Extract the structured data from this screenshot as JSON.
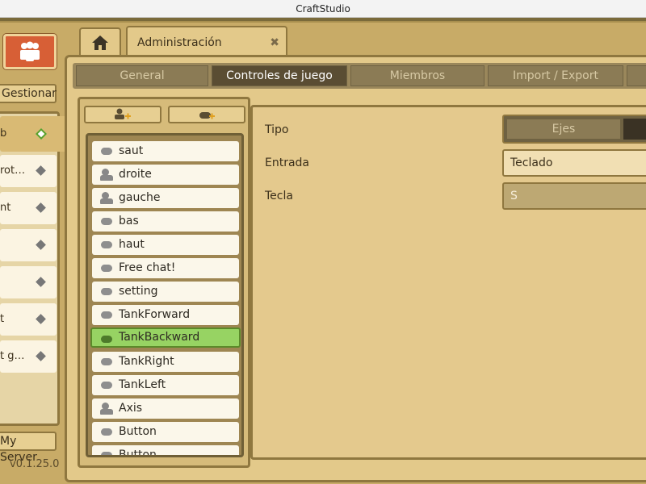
{
  "window": {
    "title": "CraftStudio"
  },
  "sidebar": {
    "manage_label": "Gestionar",
    "projects": [
      {
        "label": "b",
        "selected": true
      },
      {
        "label": "rot…"
      },
      {
        "label": "nt"
      },
      {
        "label": ""
      },
      {
        "label": ""
      },
      {
        "label": "t"
      },
      {
        "label": "t g…"
      }
    ],
    "server_label": "My Server",
    "version": "v0.1.25.0"
  },
  "tabs": {
    "home_icon": "home-icon",
    "admin_label": "Administración",
    "admin_close": "✖"
  },
  "subtabs": [
    "General",
    "Controles de juego",
    "Miembros",
    "Import / Export"
  ],
  "active_subtab": "Controles de juego",
  "controls": [
    {
      "label": "saut",
      "icon": "button-pill-icon"
    },
    {
      "label": "droite",
      "icon": "axis-person-icon"
    },
    {
      "label": "gauche",
      "icon": "axis-person-icon"
    },
    {
      "label": "bas",
      "icon": "button-pill-icon"
    },
    {
      "label": "haut",
      "icon": "button-pill-icon"
    },
    {
      "label": "Free chat!",
      "icon": "button-pill-icon"
    },
    {
      "label": "setting",
      "icon": "button-pill-icon"
    },
    {
      "label": "TankForward",
      "icon": "button-pill-icon"
    },
    {
      "label": "TankBackward",
      "icon": "button-pill-icon",
      "selected": true
    },
    {
      "label": "TankRight",
      "icon": "button-pill-icon"
    },
    {
      "label": "TankLeft",
      "icon": "button-pill-icon"
    },
    {
      "label": "Axis",
      "icon": "axis-person-icon"
    },
    {
      "label": "Button",
      "icon": "button-pill-icon"
    },
    {
      "label": "Button",
      "icon": "button-pill-icon"
    }
  ],
  "form": {
    "tipo_label": "Tipo",
    "tipo_option": "Ejes",
    "entrada_label": "Entrada",
    "entrada_value": "Teclado",
    "tecla_label": "Tecla",
    "tecla_value": "S"
  },
  "colors": {
    "accent_orange": "#d75f36",
    "selected_green": "#97d363",
    "panel_tan": "#e3c98a"
  }
}
